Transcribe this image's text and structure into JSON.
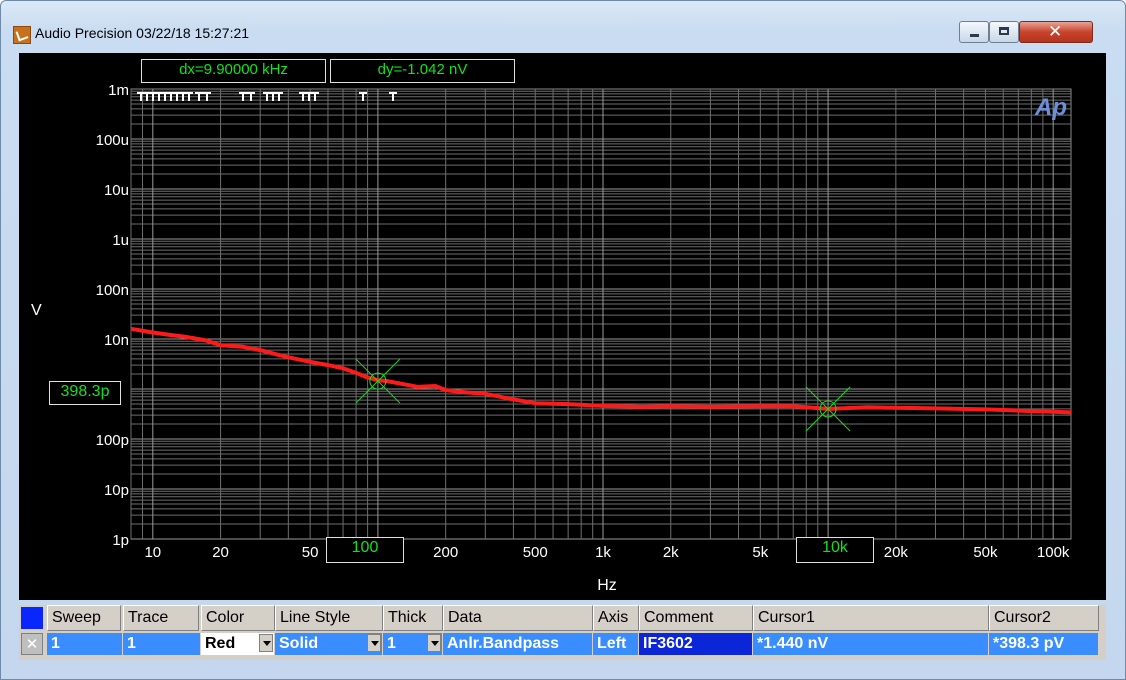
{
  "window": {
    "title": "Audio Precision  03/22/18 15:27:21",
    "buttons": {
      "minimize": "minimize",
      "maximize": "maximize",
      "close": "✕"
    }
  },
  "graph": {
    "dx_label": "dx=9.90000 kHz",
    "dy_label": "dy=-1.042  nV",
    "y_unit": "V",
    "x_unit": "Hz",
    "y_ticks": [
      "1m",
      "100u",
      "10u",
      "1u",
      "100n",
      "10n",
      "398.3p",
      "100p",
      "10p",
      "1p"
    ],
    "x_ticks": [
      "10",
      "20",
      "50",
      "100",
      "200",
      "500",
      "1k",
      "2k",
      "5k",
      "10k",
      "20k",
      "50k",
      "100k"
    ],
    "cursor1_x_label": "100",
    "cursor2_x_label": "10k",
    "cursor_y_label": "398.3p",
    "logo": "Ap"
  },
  "chart_data": {
    "type": "line",
    "xlabel": "Hz",
    "ylabel": "V",
    "x_scale": "log",
    "y_scale": "log",
    "xlim": [
      8,
      120000
    ],
    "ylim": [
      1e-12,
      0.001
    ],
    "grid": true,
    "series": [
      {
        "color": "#ff1a1a",
        "x": [
          8,
          10,
          12,
          14,
          17,
          20,
          25,
          30,
          35,
          40,
          50,
          60,
          70,
          80,
          90,
          100,
          110,
          130,
          150,
          180,
          200,
          250,
          300,
          400,
          500,
          700,
          1000,
          1500,
          2000,
          3000,
          5000,
          7000,
          10000,
          15000,
          20000,
          30000,
          50000,
          70000,
          100000,
          120000
        ],
        "y": [
          1.6e-08,
          1.35e-08,
          1.2e-08,
          1.1e-08,
          9.5e-09,
          7.5e-09,
          7e-09,
          6e-09,
          5e-09,
          4.3e-09,
          3.5e-09,
          3e-09,
          2.6e-09,
          2.1e-09,
          1.7e-09,
          1.5e-09,
          1.44e-09,
          1.25e-09,
          1.1e-09,
          1.15e-09,
          9.5e-10,
          8.5e-10,
          8e-10,
          6.2e-10,
          5.2e-10,
          5e-10,
          4.6e-10,
          4.4e-10,
          4.5e-10,
          4.4e-10,
          4.5e-10,
          4.5e-10,
          4e-10,
          4.3e-10,
          4.2e-10,
          4.1e-10,
          3.9e-10,
          3.7e-10,
          3.5e-10,
          3.4e-10
        ]
      }
    ],
    "cursors": [
      {
        "x": 100,
        "y": 1.44e-09
      },
      {
        "x": 10000,
        "y": 3.983e-10
      }
    ]
  },
  "table": {
    "headers": [
      "Sweep",
      "Trace",
      "Color",
      "Line Style",
      "Thick",
      "Data",
      "Axis",
      "Comment",
      "Cursor1",
      "Cursor2"
    ],
    "row": {
      "check": "✕",
      "sweep": "1",
      "trace": "1",
      "color": "Red",
      "line_style": "Solid",
      "thick": "1",
      "data": "Anlr.Bandpass",
      "axis": "Left",
      "comment": "IF3602",
      "cursor1": "*1.440  nV",
      "cursor2": "*398.3  pV"
    }
  }
}
